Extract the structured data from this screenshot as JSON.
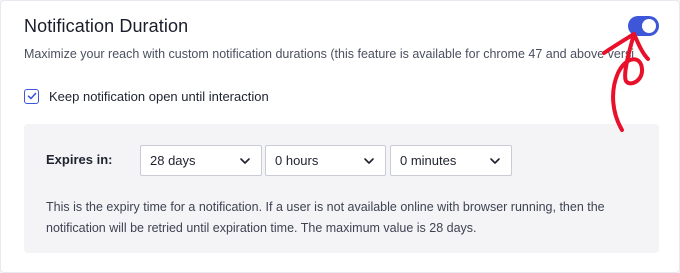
{
  "section": {
    "title": "Notification Duration",
    "toggle_on": true,
    "description": "Maximize your reach with custom notification durations (this feature is available for chrome 47 and above versions only)"
  },
  "checkbox": {
    "checked": true,
    "label": "Keep notification open until interaction"
  },
  "expires": {
    "label": "Expires in:",
    "days": "28 days",
    "hours": "0 hours",
    "minutes": "0 minutes",
    "help_text": "This is the expiry time for a notification. If a user is not available online with browser running, then the notification will be retried until expiration time. The maximum value is 28 days."
  },
  "colors": {
    "accent": "#3d57d8",
    "annotation": "#e8102a",
    "panel_bg": "#f4f4f7"
  },
  "icons": [
    "toggle-switch",
    "checkmark-icon",
    "chevron-down-icon",
    "arrow-annotation"
  ]
}
